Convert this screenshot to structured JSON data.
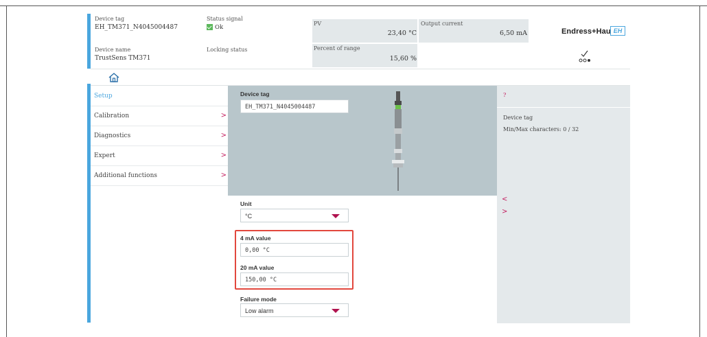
{
  "header": {
    "device_tag_label": "Device tag",
    "device_tag_value": "EH_TM371_N4045004487",
    "device_name_label": "Device name",
    "device_name_value": "TrustSens TM371",
    "status_signal_label": "Status signal",
    "status_signal_value": "Ok",
    "locking_status_label": "Locking status",
    "pv_label": "PV",
    "pv_value": "23,40 °C",
    "percent_label": "Percent of range",
    "percent_value": "15,60 %",
    "output_current_label": "Output current",
    "output_current_value": "6,50 mA",
    "brand": "Endress+Hauser",
    "brand_logo": "EH"
  },
  "nav": {
    "items": [
      {
        "label": "Setup"
      },
      {
        "label": "Calibration",
        "chevron": ">"
      },
      {
        "label": "Diagnostics",
        "chevron": ">"
      },
      {
        "label": "Expert",
        "chevron": ">"
      },
      {
        "label": "Additional functions",
        "chevron": ">"
      }
    ]
  },
  "main": {
    "device_tag_label": "Device tag",
    "device_tag_value": "EH_TM371_N4045004487",
    "unit_label": "Unit",
    "unit_value": "°C",
    "ma4_label": "4 mA value",
    "ma4_value": "0,00 °C",
    "ma20_label": "20 mA value",
    "ma20_value": "150,00 °C",
    "failure_label": "Failure mode",
    "failure_value": "Low alarm"
  },
  "help": {
    "question": "?",
    "title": "Device tag",
    "text": "Min/Max characters: 0 / 32",
    "collapse_left": "<",
    "expand_right": ">"
  },
  "colors": {
    "accent_blue": "#4aa6de",
    "accent_magenta": "#c2185b",
    "highlight_red": "#e2473d",
    "panel_gray": "#e4e9eb",
    "image_bg": "#b8c6cb",
    "status_green": "#5cb85c"
  }
}
